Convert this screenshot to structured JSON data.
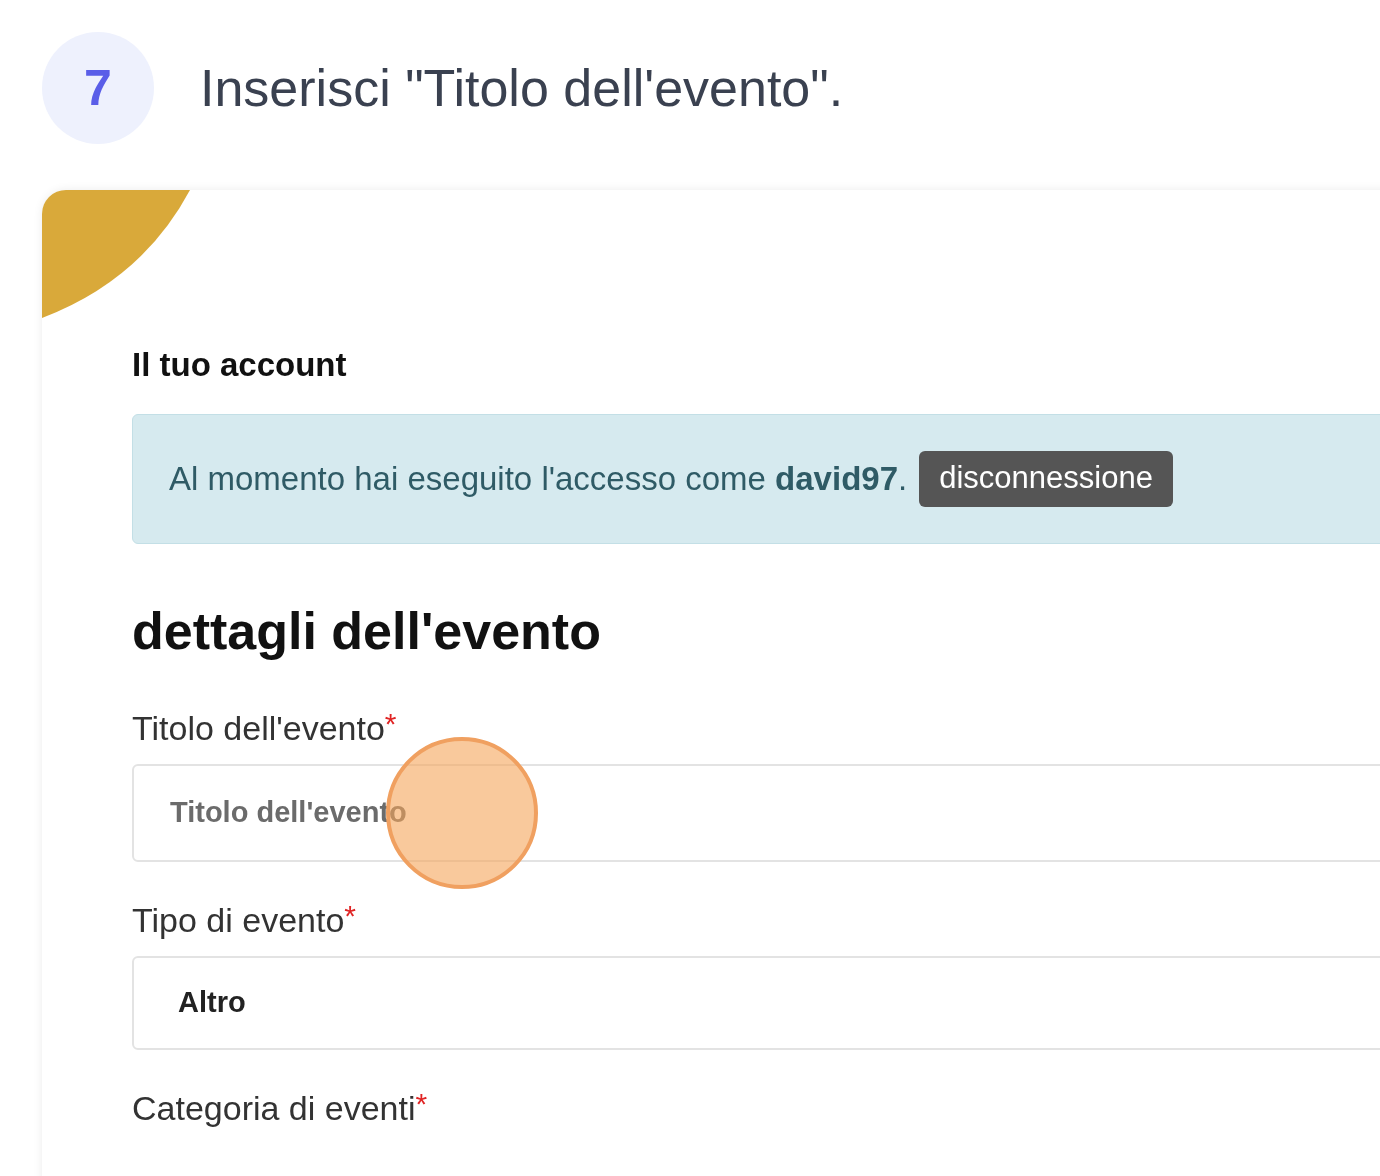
{
  "step": {
    "number": "7",
    "title": "Inserisci \"Titolo dell'evento\"."
  },
  "account": {
    "heading": "Il tuo account",
    "message": "Al momento hai eseguito l'accesso come **david97**.",
    "logout_button": "disconnessione"
  },
  "section_heading": "dettagli dell'evento",
  "fields": [
    {
      "kind": "input",
      "label": "Titolo dell'evento",
      "required_mark": "*",
      "placeholder": "Titolo dell'evento",
      "highlighted": true
    },
    {
      "kind": "select",
      "label": "Tipo di evento",
      "required_mark": "*",
      "value": "Altro",
      "highlighted": false
    },
    {
      "kind": "none",
      "label": "Categoria di eventi",
      "required_mark": "*",
      "highlighted": false
    }
  ]
}
